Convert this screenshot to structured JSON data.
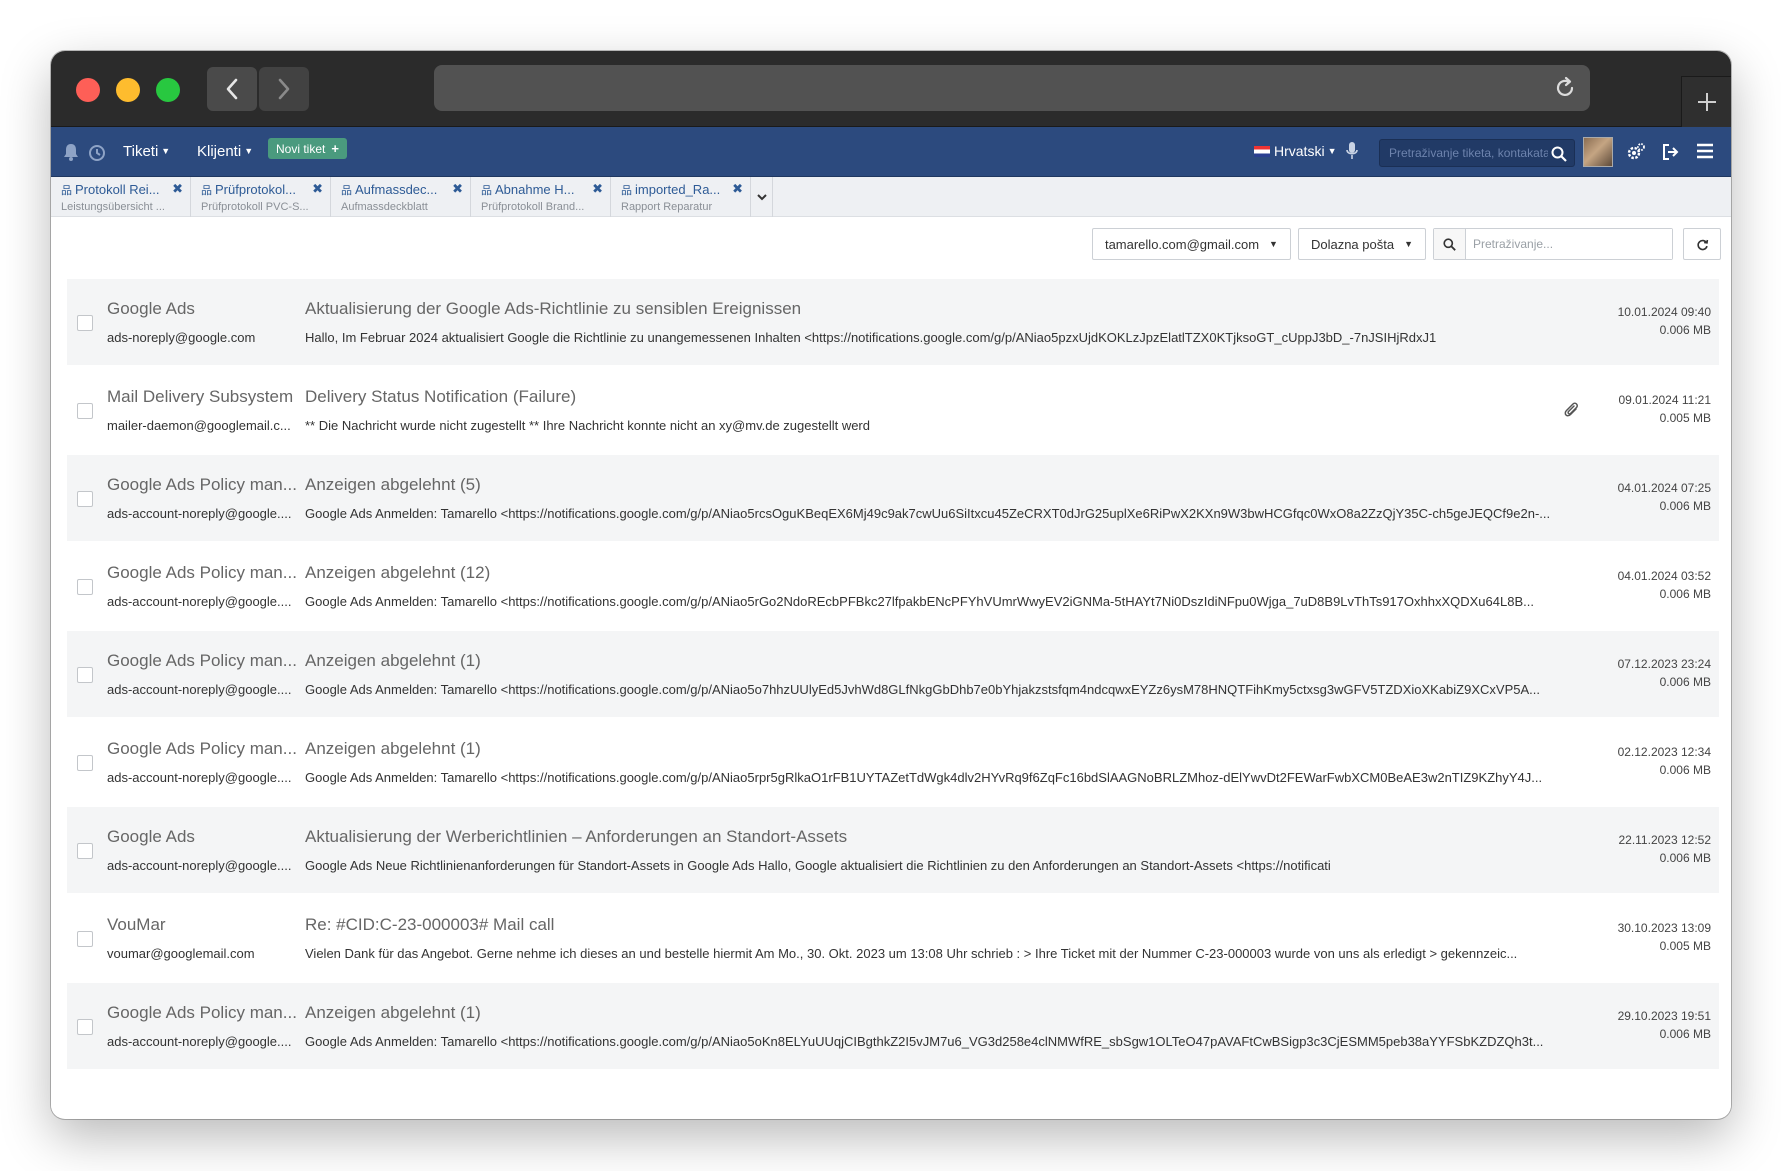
{
  "app_header": {
    "menu_tickets": "Tiketi",
    "menu_clients": "Klijenti",
    "new_ticket": "Novi tiket",
    "language": "Hrvatski",
    "search_placeholder": "Pretraživanje tiketa, kontakata"
  },
  "tabs": [
    {
      "title": "Protokoll Rei...",
      "subtitle": "Leistungsübersicht ..."
    },
    {
      "title": "Prüfprotokol...",
      "subtitle": "Prüfprotokoll PVC-S..."
    },
    {
      "title": "Aufmassdec...",
      "subtitle": "Aufmassdeckblatt"
    },
    {
      "title": "Abnahme H...",
      "subtitle": "Prüfprotokoll Brand..."
    },
    {
      "title": "imported_Ra...",
      "subtitle": "Rapport Reparatur"
    }
  ],
  "toolbar": {
    "account": "tamarello.com@gmail.com",
    "folder": "Dolazna pošta",
    "search_placeholder": "Pretraživanje..."
  },
  "messages": [
    {
      "sender": "Google Ads",
      "email": "ads-noreply@google.com",
      "subject": "Aktualisierung der Google Ads-Richtlinie zu sensiblen Ereignissen",
      "preview": "Hallo, Im Februar 2024 aktualisiert Google die Richtlinie zu unangemessenen Inhalten <https://notifications.google.com/g/p/ANiao5pzxUjdKOKLzJpzElatlTZX0KTjksoGT_cUppJ3bD_-7nJSIHjRdxJ1",
      "date": "10.01.2024 09:40",
      "size": "0.006 MB",
      "attachment": false
    },
    {
      "sender": "Mail Delivery Subsystem",
      "email": "mailer-daemon@googlemail.c...",
      "subject": "Delivery Status Notification (Failure)",
      "preview": "** Die Nachricht wurde nicht zugestellt ** Ihre Nachricht konnte nicht an xy@mv.de zugestellt werd",
      "date": "09.01.2024 11:21",
      "size": "0.005 MB",
      "attachment": true
    },
    {
      "sender": "Google Ads Policy man...",
      "email": "ads-account-noreply@google....",
      "subject": "Anzeigen abgelehnt (5)",
      "preview": "Google Ads Anmelden: Tamarello <https://notifications.google.com/g/p/ANiao5rcsOguKBeqEX6Mj49c9ak7cwUu6SiItxcu45ZeCRXT0dJrG25uplXe6RiPwX2KXn9W3bwHCGfqc0WxO8a2ZzQjY35C-ch5geJEQCf9e2n-...",
      "date": "04.01.2024 07:25",
      "size": "0.006 MB",
      "attachment": false
    },
    {
      "sender": "Google Ads Policy man...",
      "email": "ads-account-noreply@google....",
      "subject": "Anzeigen abgelehnt (12)",
      "preview": "Google Ads Anmelden: Tamarello <https://notifications.google.com/g/p/ANiao5rGo2NdoREcbPFBkc27lfpakbENcPFYhVUmrWwyEV2iGNMa-5tHAYt7Ni0DszIdiNFpu0Wjga_7uD8B9LvThTs917OxhhxXQDXu64L8B...",
      "date": "04.01.2024 03:52",
      "size": "0.006 MB",
      "attachment": false
    },
    {
      "sender": "Google Ads Policy man...",
      "email": "ads-account-noreply@google....",
      "subject": "Anzeigen abgelehnt (1)",
      "preview": "Google Ads Anmelden: Tamarello <https://notifications.google.com/g/p/ANiao5o7hhzUUlyEd5JvhWd8GLfNkgGbDhb7e0bYhjakzstsfqm4ndcqwxEYZz6ysM78HNQTFihKmy5ctxsg3wGFV5TZDXioXKabiZ9XCxVP5A...",
      "date": "07.12.2023 23:24",
      "size": "0.006 MB",
      "attachment": false
    },
    {
      "sender": "Google Ads Policy man...",
      "email": "ads-account-noreply@google....",
      "subject": "Anzeigen abgelehnt (1)",
      "preview": "Google Ads Anmelden: Tamarello <https://notifications.google.com/g/p/ANiao5rpr5gRlkaO1rFB1UYTAZetTdWgk4dlv2HYvRq9f6ZqFc16bdSlAAGNoBRLZMhoz-dElYwvDt2FEWarFwbXCM0BeAE3w2nTIZ9KZhyY4J...",
      "date": "02.12.2023 12:34",
      "size": "0.006 MB",
      "attachment": false
    },
    {
      "sender": "Google Ads",
      "email": "ads-account-noreply@google....",
      "subject": "Aktualisierung der Werberichtlinien – Anforderungen an Standort-Assets",
      "preview": "Google Ads Neue Richtlinienanforderungen für Standort-Assets in Google Ads Hallo, Google aktualisiert die Richtlinien zu den Anforderungen an Standort-Assets <https://notificati",
      "date": "22.11.2023 12:52",
      "size": "0.006 MB",
      "attachment": false
    },
    {
      "sender": "VouMar",
      "email": "voumar@googlemail.com",
      "subject": "Re: #CID:C-23-000003# Mail call",
      "preview": "Vielen Dank für das Angebot. Gerne nehme ich dieses an und bestelle hiermit Am Mo., 30. Okt. 2023 um 13:08 Uhr schrieb : > Ihre Ticket mit der Nummer C-23-000003 wurde von uns als erledigt > gekennzeic...",
      "date": "30.10.2023 13:09",
      "size": "0.005 MB",
      "attachment": false
    },
    {
      "sender": "Google Ads Policy man...",
      "email": "ads-account-noreply@google....",
      "subject": "Anzeigen abgelehnt (1)",
      "preview": "Google Ads Anmelden: Tamarello <https://notifications.google.com/g/p/ANiao5oKn8ELYuUUqjCIBgthkZ2I5vJM7u6_VG3d258e4clNMWfRE_sbSgw1OLTeO47pAVAFtCwBSigp3c3CjESMM5peb38aYYFSbKZDZQh3t...",
      "date": "29.10.2023 19:51",
      "size": "0.006 MB",
      "attachment": false
    }
  ],
  "colors": {
    "header_bg": "#2c4a7e",
    "new_ticket_bg": "#4a9a7e",
    "tab_text": "#2e5b96"
  }
}
